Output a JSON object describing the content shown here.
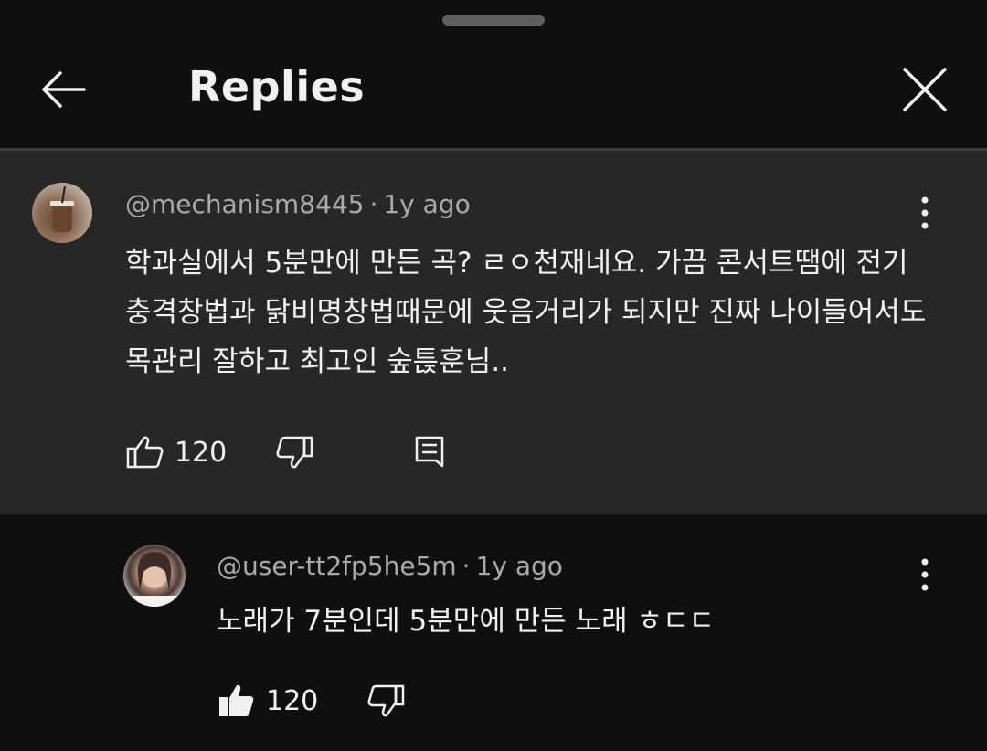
{
  "header": {
    "title": "Replies",
    "back_icon": "arrow-left-icon",
    "close_icon": "close-icon"
  },
  "parent_comment": {
    "author": "@mechanism8445",
    "separator": "·",
    "time": "1y ago",
    "text": "학과실에서 5분만에 만든 곡? ㄹㅇ천재네요. 가끔 콘서트땜에 전기충격창법과 닭비명창법때문에 웃음거리가 되지만 진짜 나이들어서도 목관리 잘하고 최고인 숲튽훈님..",
    "likes": "120",
    "like_icon": "thumbs-up-outline-icon",
    "dislike_icon": "thumbs-down-outline-icon",
    "reply_icon": "comment-icon",
    "menu_icon": "more-vertical-icon"
  },
  "reply_comment": {
    "author": "@user-tt2fp5he5m",
    "separator": "·",
    "time": "1y ago",
    "text": "노래가 7분인데 5분만에 만든 노래 ㅎㄷㄷ",
    "likes": "120",
    "like_icon": "thumbs-up-filled-icon",
    "dislike_icon": "thumbs-down-outline-icon",
    "menu_icon": "more-vertical-icon"
  },
  "colors": {
    "background": "#0f0f0f",
    "highlight": "#272727",
    "text": "#f1f1f1",
    "meta": "#aaaaaa"
  }
}
